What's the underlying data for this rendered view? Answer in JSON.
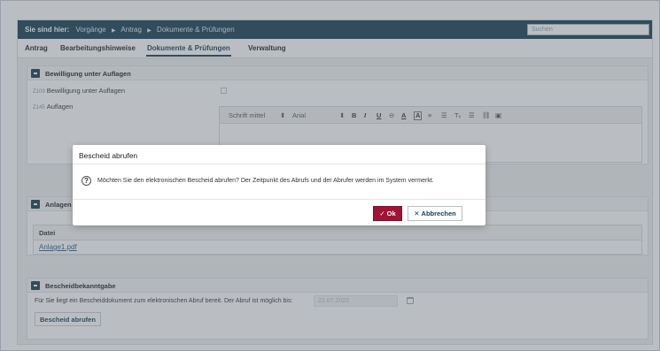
{
  "breadcrumb": {
    "prefix": "Sie sind hier:",
    "items": [
      "Vorgänge",
      "Antrag",
      "Dokumente & Prüfungen"
    ]
  },
  "search": {
    "placeholder": "Suchen"
  },
  "tabs": [
    {
      "label": "Antrag",
      "active": false
    },
    {
      "label": "Bearbeitungshinweise",
      "active": false
    },
    {
      "label": "Dokumente & Prüfungen",
      "active": true
    },
    {
      "label": "Verwaltung",
      "active": false
    }
  ],
  "section_bewilligung": {
    "title": "Bewilligung unter Auflagen",
    "field1": {
      "code": "Z109",
      "label": "Bewilligung unter Auflagen"
    },
    "field2": {
      "code": "Z145",
      "label": "Auflagen"
    },
    "editor_toolbar": {
      "font_size": "Schrift mittel",
      "font_family": "Arial",
      "bold": "B",
      "italic": "I",
      "underline": "U",
      "strike": "⊖",
      "font_color": "A",
      "bg_color": "A",
      "ordered_list": "≡",
      "bullet_list": "☰",
      "clear_format": "Tₓ",
      "align": "☰",
      "link": "⛓",
      "image": "▣"
    }
  },
  "section_anlagen": {
    "title": "Anlagen",
    "column_header": "Datei",
    "files": [
      "Anlage1.pdf"
    ]
  },
  "section_bescheid": {
    "title": "Bescheidbekanntgabe",
    "info_text": "Für Sie liegt ein Bescheiddokument zum elektronischen Abruf bereit. Der Abruf ist möglich bis:",
    "date_value": "22.07.2022",
    "button_label": "Bescheid abrufen"
  },
  "modal": {
    "title": "Bescheid abrufen",
    "message": "Möchten Sie den elektronischen Bescheid abrufen? Der Zeitpunkt des Abrufs und der Abrufer werden im System vermerkt.",
    "ok_label": "Ok",
    "cancel_label": "Abbrechen",
    "ok_color": "#9e1435"
  }
}
